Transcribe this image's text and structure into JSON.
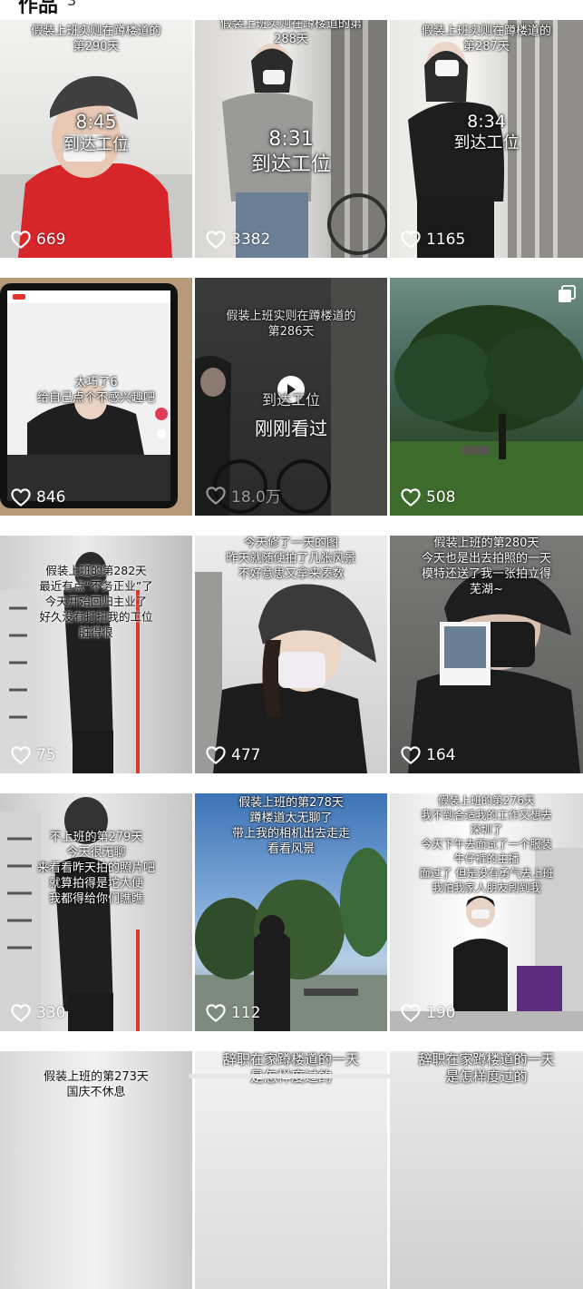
{
  "header": {
    "title": "作品",
    "count": "3"
  },
  "colors": {
    "overlay_text": "#ffffff",
    "like_icon": "#ffffff"
  },
  "tiles": [
    {
      "caption": "假装上班实则在蹲楼道的\n第290天",
      "time": "8:45",
      "arrive": "到达工位",
      "likes": "669"
    },
    {
      "caption": "假装上班实则在蹲楼道的第\n288天",
      "time": "8:31",
      "arrive": "到达工位",
      "likes": "3382"
    },
    {
      "caption": "假装上班实则在蹲楼道的\n第287天",
      "time": "8:34",
      "arrive": "到达工位",
      "likes": "1165"
    },
    {
      "caption": "太巧了6\n给自己点个不感兴趣吧",
      "likes": "846"
    },
    {
      "caption": "假装上班实则在蹲楼道的\n第286天",
      "arrive": "到达工位",
      "watched": "刚刚看过",
      "likes": "18.0万",
      "icon": "play-icon"
    },
    {
      "likes": "508",
      "icon": "multi-image-icon"
    },
    {
      "caption": "假装上班的第282天\n最近有点“不务正业”了\n今天开始回归主业了\n好久没有打扫我的工位\n脏得很",
      "likes": "75"
    },
    {
      "caption": "今天修了一天的图\n昨天就随便拍了几张风景\n不好意思又拿来凑数",
      "likes": "477"
    },
    {
      "caption": "假装上班的第280天\n今天也是出去拍照的一天\n模特还送了我一张拍立得\n芜湖~",
      "likes": "164"
    },
    {
      "caption": "不上班的第279天\n今天很无聊\n来看看昨天拍的照片吧\n就算拍得是坨大便\n我都得给你们瞧瞧",
      "likes": "330"
    },
    {
      "caption": "假装上班的第278天\n蹲楼道太无聊了\n带上我的相机出去走走\n看看风景",
      "likes": "112"
    },
    {
      "caption": "假装上班的第276天\n我不到合适我的工作又想去\n深圳了\n今天下午去面试了一个服装\n牛仔裤的主播\n面过了 但是没有勇气去上班\n我怕我家人朋友刷到我",
      "likes": "190"
    },
    {
      "caption": "假装上班的第273天\n国庆不休息"
    },
    {
      "caption": "辞职在家蹲楼道的一天\n是怎样度过的"
    },
    {
      "caption": "辞职在家蹲楼道的一天\n是怎样度过的"
    }
  ]
}
